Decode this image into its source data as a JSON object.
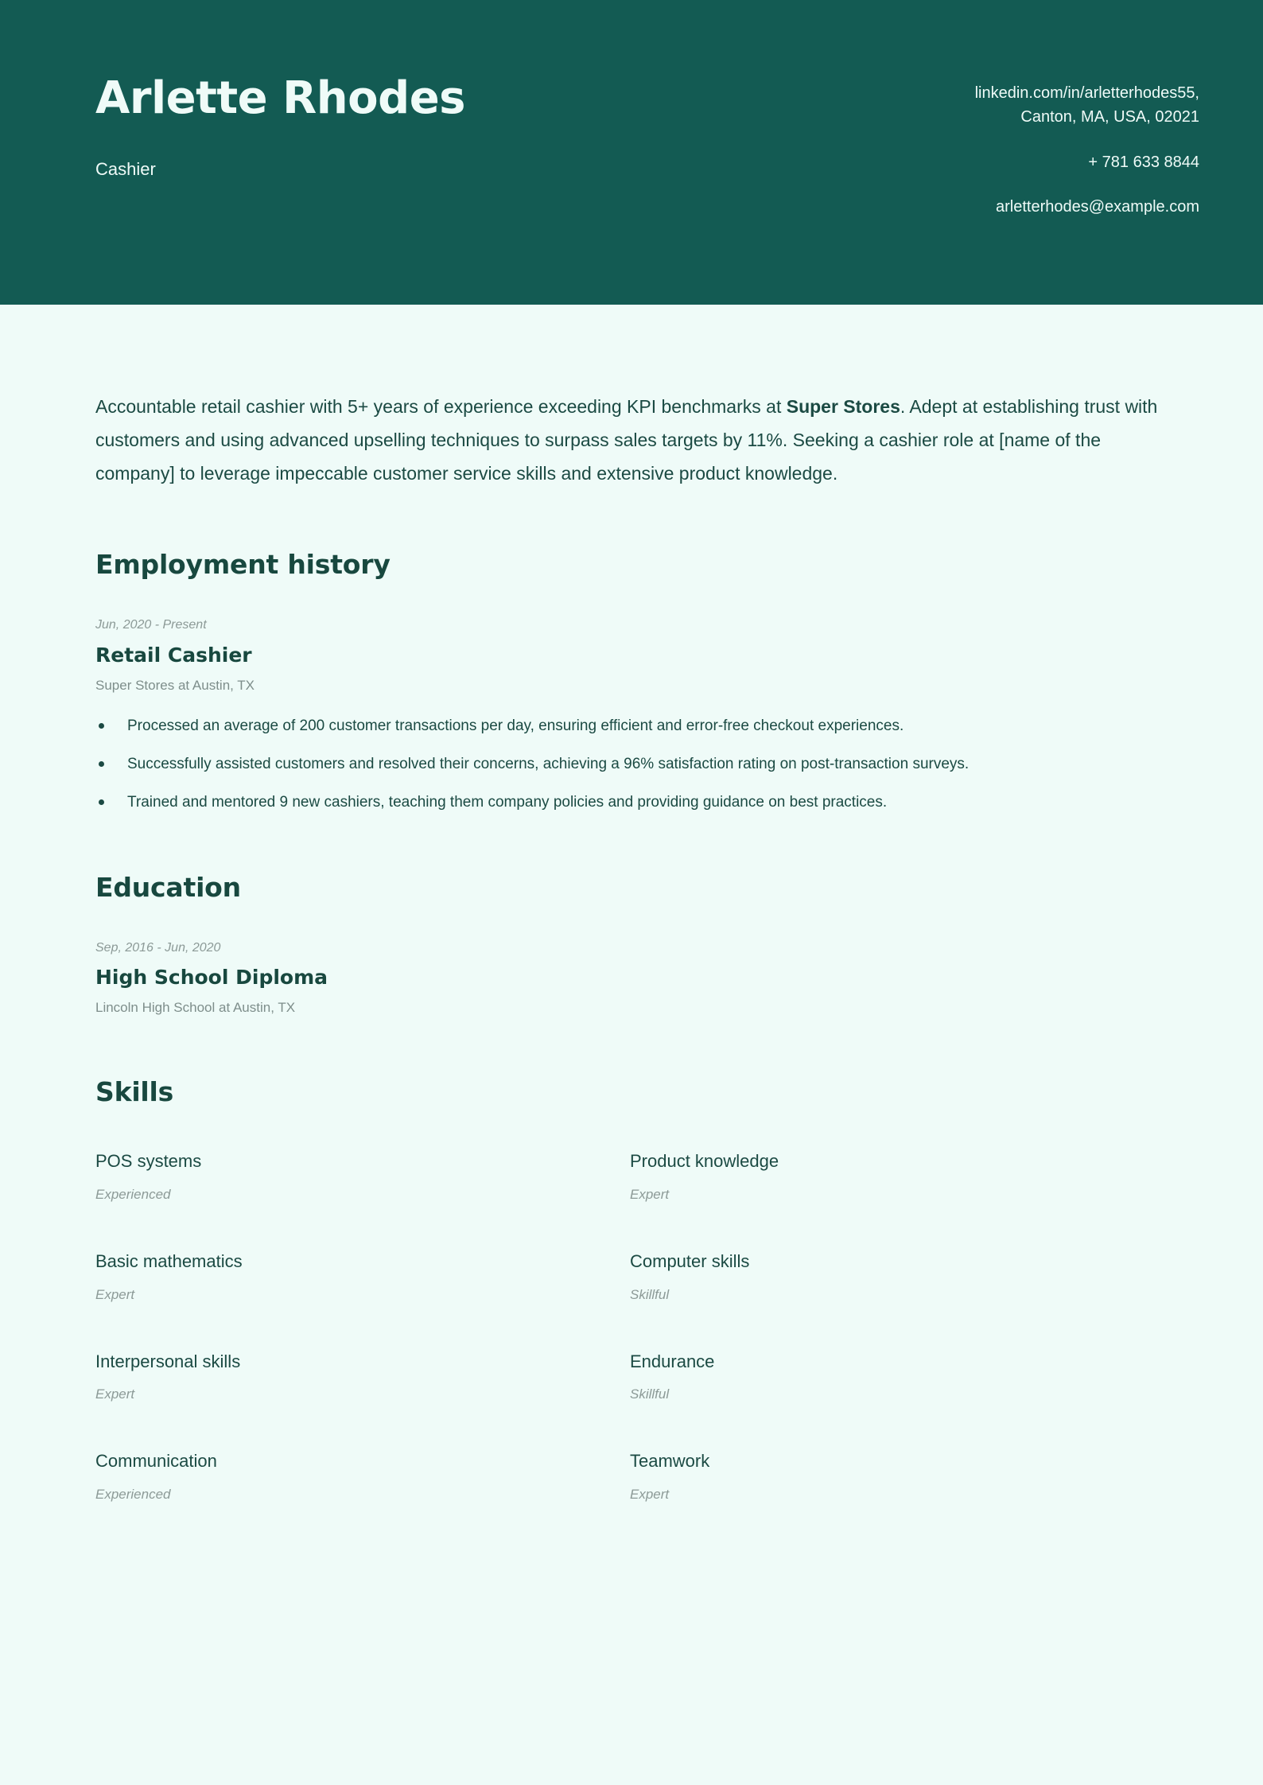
{
  "header": {
    "name": "Arlette Rhodes",
    "job_title": "Cashier",
    "contact": {
      "linkedin": "linkedin.com/in/arletterhodes55,",
      "location": "Canton, MA, USA, 02021",
      "phone": "+ 781 633 8844",
      "email": "arletterhodes@example.com"
    },
    "band_color": "#135B53",
    "text_color": "#EFFBF8"
  },
  "page": {
    "background_color": "#EFFBF8",
    "heading_color": "#18483F",
    "body_text_color": "#1B4A43",
    "muted_text_color": "#8C9A97"
  },
  "summary": {
    "part1": "Accountable retail cashier with 5+ years of experience exceeding KPI benchmarks at ",
    "highlight": "Super Stores",
    "part2": ". Adept at establishing trust with customers and using advanced upselling techniques to surpass sales targets by 11%. Seeking a cashier role at [name of the company] to leverage impeccable customer service skills and extensive product knowledge."
  },
  "employment": {
    "title": "Employment history",
    "entries": [
      {
        "date": "Jun, 2020 - Present",
        "role": "Retail Cashier",
        "organization": "Super Stores at Austin, TX",
        "bullets": [
          "Processed an average of 200 customer transactions per day, ensuring efficient and error-free checkout experiences.",
          "Successfully assisted customers and resolved their concerns, achieving a 96% satisfaction rating on post-transaction surveys.",
          "Trained and mentored 9 new cashiers, teaching them company policies and providing guidance on best practices."
        ]
      }
    ]
  },
  "education": {
    "title": "Education",
    "entries": [
      {
        "date": "Sep, 2016 - Jun, 2020",
        "role": "High School Diploma",
        "organization": "Lincoln High School at Austin, TX"
      }
    ]
  },
  "skills": {
    "title": "Skills",
    "items": [
      {
        "name": "POS systems",
        "level": "Experienced"
      },
      {
        "name": "Product knowledge",
        "level": "Expert"
      },
      {
        "name": "Basic mathematics",
        "level": "Expert"
      },
      {
        "name": "Computer skills",
        "level": "Skillful"
      },
      {
        "name": "Interpersonal skills",
        "level": "Expert"
      },
      {
        "name": "Endurance",
        "level": "Skillful"
      },
      {
        "name": "Communication",
        "level": "Experienced"
      },
      {
        "name": "Teamwork",
        "level": "Expert"
      }
    ]
  }
}
